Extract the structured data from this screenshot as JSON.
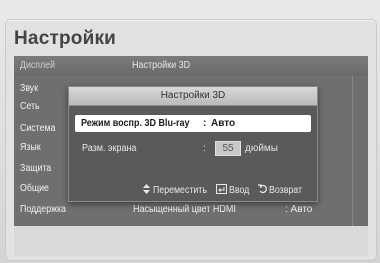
{
  "page": {
    "title": "Настройки"
  },
  "sidebar": {
    "items": [
      {
        "label": "Дисплей",
        "dim": true
      },
      {
        "label": "Звук",
        "dim": false
      },
      {
        "label": "Сеть",
        "dim": false
      },
      {
        "label": "Система",
        "dim": false
      },
      {
        "label": "Язык",
        "dim": false
      },
      {
        "label": "Защита",
        "dim": false
      },
      {
        "label": "Общие",
        "dim": false
      },
      {
        "label": "Поддержка",
        "dim": false
      }
    ]
  },
  "main": {
    "header_title": "Настройки 3D",
    "hdmi_label": "Насыщенный цвет HDMI",
    "hdmi_value": ": Авто"
  },
  "popup": {
    "title": "Настройки 3D",
    "row1": {
      "label": "Режим воспр. 3D Blu-ray",
      "colon": ":",
      "value": "Авто"
    },
    "row2": {
      "label": "Разм. экрана",
      "colon": ":",
      "value": "55",
      "unit": "дюймы"
    },
    "footer": {
      "move_icon": "updown-arrows-icon",
      "move_label": "Переместить",
      "enter_icon": "enter-icon",
      "enter_label": "Ввод",
      "return_icon": "return-arrow-icon",
      "return_label": "Возврат"
    }
  }
}
